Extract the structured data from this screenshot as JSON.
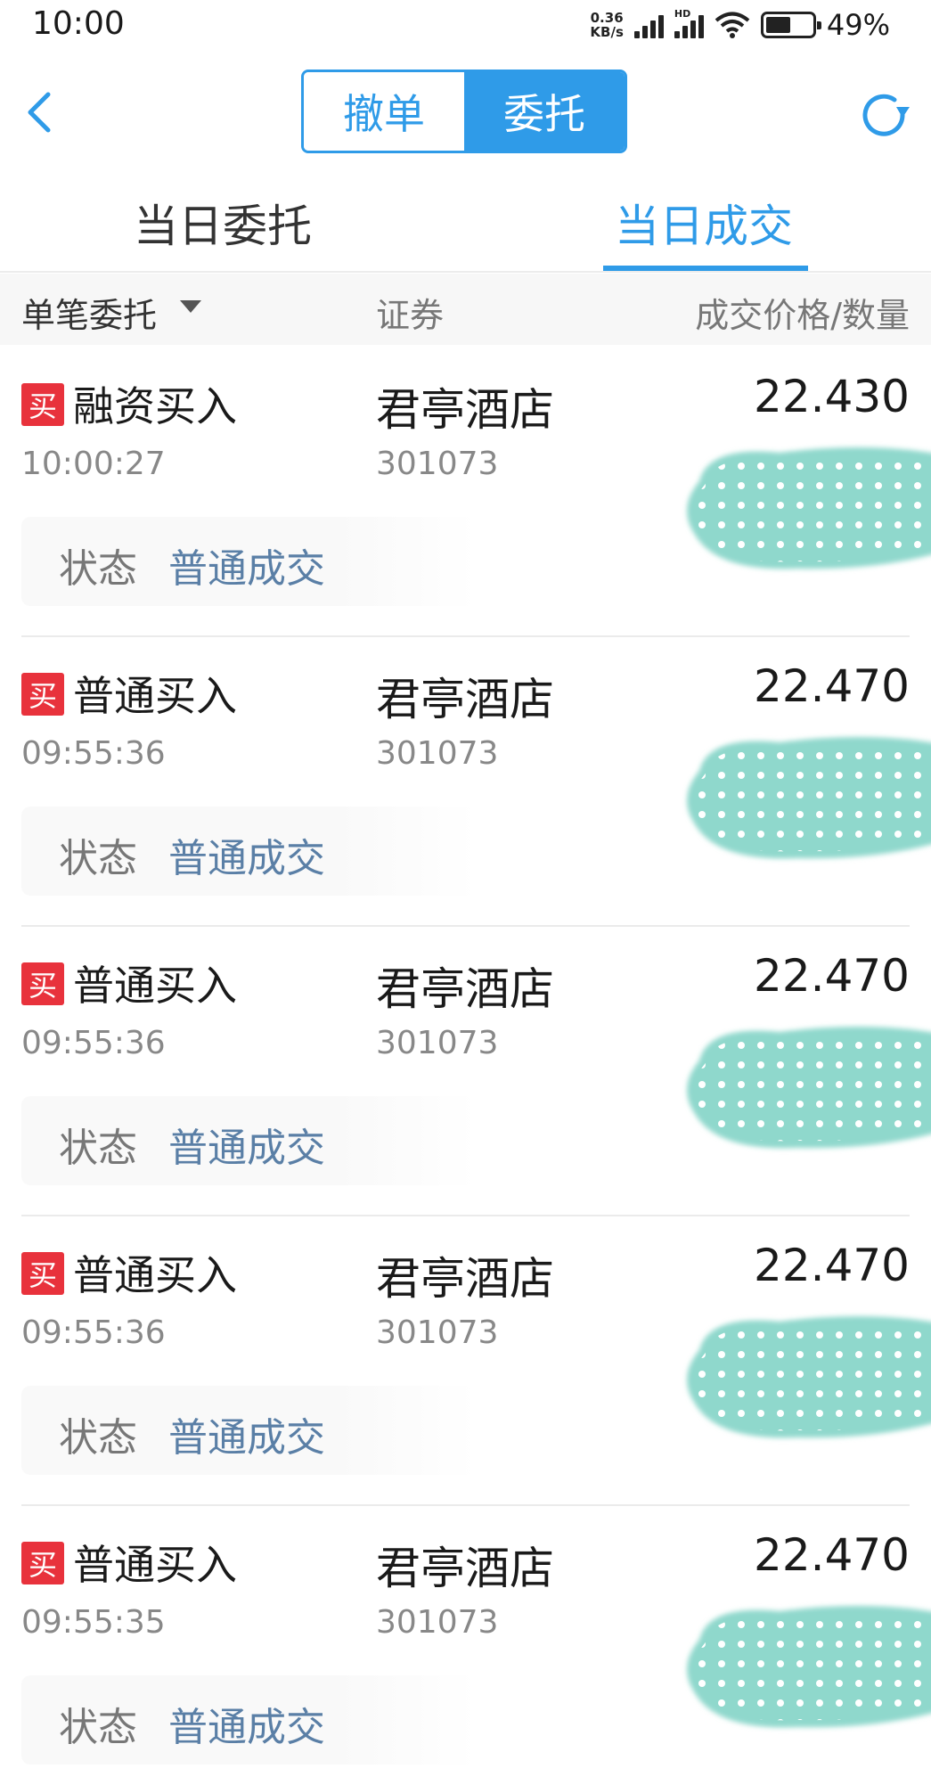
{
  "status_bar": {
    "time": "10:00",
    "net_speed_value": "0.36",
    "net_speed_unit": "KB/s",
    "hd_label": "HD",
    "battery": "49%"
  },
  "nav": {
    "segment": [
      "撤单",
      "委托"
    ],
    "active_segment": "委托"
  },
  "tabs": [
    "当日委托",
    "当日成交"
  ],
  "active_tab": "当日成交",
  "header": {
    "col1": "单笔委托",
    "col2": "证券",
    "col3": "成交价格/数量"
  },
  "rows": [
    {
      "badge": "买",
      "type": "融资买入",
      "time": "10:00:27",
      "name": "君亭酒店",
      "code": "301073",
      "price": "22.430",
      "status_label": "状态",
      "status": "普通成交"
    },
    {
      "badge": "买",
      "type": "普通买入",
      "time": "09:55:36",
      "name": "君亭酒店",
      "code": "301073",
      "price": "22.470",
      "status_label": "状态",
      "status": "普通成交"
    },
    {
      "badge": "买",
      "type": "普通买入",
      "time": "09:55:36",
      "name": "君亭酒店",
      "code": "301073",
      "price": "22.470",
      "status_label": "状态",
      "status": "普通成交"
    },
    {
      "badge": "买",
      "type": "普通买入",
      "time": "09:55:36",
      "name": "君亭酒店",
      "code": "301073",
      "price": "22.470",
      "status_label": "状态",
      "status": "普通成交"
    },
    {
      "badge": "买",
      "type": "普通买入",
      "time": "09:55:35",
      "name": "君亭酒店",
      "code": "301073",
      "price": "22.470",
      "status_label": "状态",
      "status": "普通成交"
    }
  ],
  "colors": {
    "accent": "#2f9be8",
    "buy_badge": "#e8323c",
    "status_value": "#5a7fa6",
    "redaction": "#8fd8cc"
  }
}
